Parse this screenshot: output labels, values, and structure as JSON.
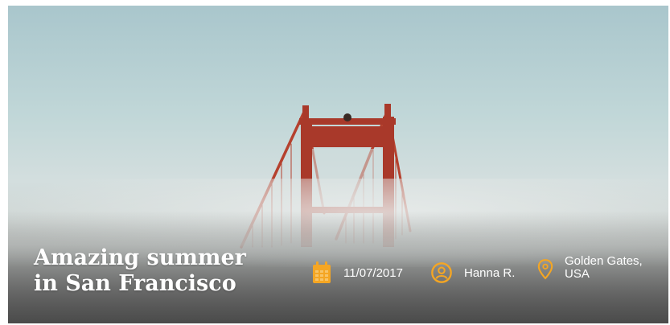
{
  "post": {
    "title_line1": "Amazing summer",
    "title_line2": "in San Francisco",
    "date": "11/07/2017",
    "author": "Hanna R.",
    "location_line1": "Golden Gates,",
    "location_line2": "USA"
  },
  "icons": {
    "date": "calendar-icon",
    "author": "user-icon",
    "location": "map-pin-icon"
  },
  "colors": {
    "accent": "#f5a623",
    "bridge": "#b5412e",
    "text": "#ffffff"
  }
}
